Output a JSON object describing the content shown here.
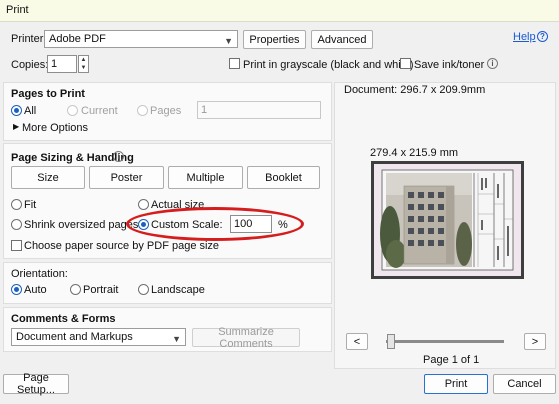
{
  "window": {
    "title": "Print"
  },
  "header": {
    "printer_label": "Printer:",
    "printer_value": "Adobe PDF",
    "properties_label": "Properties",
    "advanced_label": "Advanced",
    "help_label": "Help",
    "copies_label": "Copies:",
    "copies_value": "1",
    "grayscale_label": "Print in grayscale (black and white)",
    "save_ink_label": "Save ink/toner"
  },
  "pages_to_print": {
    "heading": "Pages to Print",
    "all_label": "All",
    "current_label": "Current",
    "pages_label": "Pages",
    "pages_value": "1",
    "more_options_label": "More Options",
    "selected": "All"
  },
  "sizing": {
    "heading": "Page Sizing & Handling",
    "tabs": [
      "Size",
      "Poster",
      "Multiple",
      "Booklet"
    ],
    "fit_label": "Fit",
    "actual_size_label": "Actual size",
    "shrink_label": "Shrink oversized pages",
    "custom_scale_label": "Custom Scale:",
    "custom_scale_value": "100",
    "percent_label": "%",
    "choose_paper_label": "Choose paper source by PDF page size",
    "selected": "Custom Scale"
  },
  "orientation": {
    "heading": "Orientation:",
    "auto_label": "Auto",
    "portrait_label": "Portrait",
    "landscape_label": "Landscape",
    "selected": "Auto"
  },
  "comments": {
    "heading": "Comments & Forms",
    "value": "Document and Markups",
    "summarize_label": "Summarize Comments"
  },
  "preview": {
    "document_label": "Document: 296.7 x 209.9mm",
    "page_size_label": "279.4 x 215.9 mm",
    "prev_label": "<",
    "next_label": ">",
    "page_indicator": "Page 1 of 1",
    "slider_position": 0.0
  },
  "footer": {
    "page_setup_label": "Page Setup...",
    "print_label": "Print",
    "cancel_label": "Cancel"
  }
}
